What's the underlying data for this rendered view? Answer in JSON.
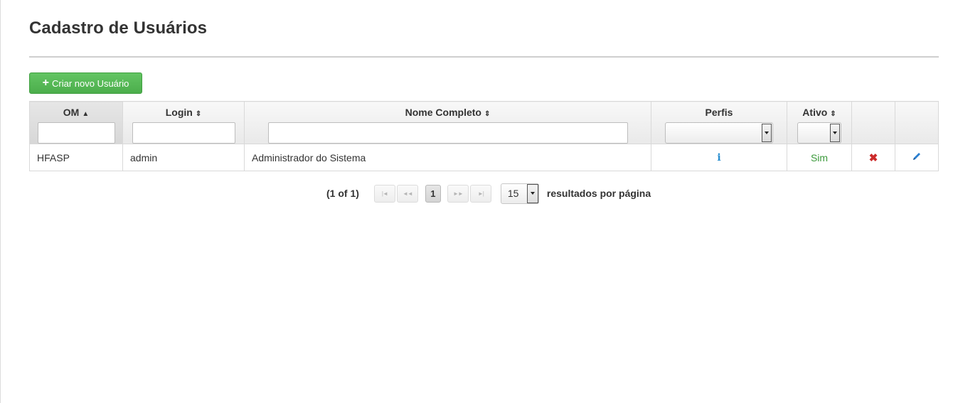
{
  "page": {
    "title": "Cadastro de Usuários"
  },
  "toolbar": {
    "create_label": "Criar novo Usuário",
    "create_icon": "plus-icon"
  },
  "table": {
    "columns": [
      {
        "label": "OM",
        "sort": "ascending",
        "filter": "text"
      },
      {
        "label": "Login",
        "sort": "unsorted",
        "filter": "text"
      },
      {
        "label": "Nome Completo",
        "sort": "unsorted",
        "filter": "text"
      },
      {
        "label": "Perfis",
        "sort": "none",
        "filter": "select"
      },
      {
        "label": "Ativo",
        "sort": "unsorted",
        "filter": "select"
      },
      {
        "label": "",
        "sort": "none",
        "filter": "none"
      },
      {
        "label": "",
        "sort": "none",
        "filter": "none"
      }
    ],
    "sort_icons": {
      "ascending": "▲",
      "unsorted": "⇕"
    },
    "rows": [
      {
        "om": "HFASP",
        "login": "admin",
        "nome": "Administrador do Sistema",
        "perfis_icon": "info-icon",
        "ativo": "Sim",
        "delete_icon": "close-icon",
        "edit_icon": "pencil-icon"
      }
    ]
  },
  "pagination": {
    "current_label": "(1 of 1)",
    "first_glyph": "|◄",
    "prev_glyph": "◄◄",
    "current_page": "1",
    "next_glyph": "►►",
    "last_glyph": "►|",
    "rows_per_page": "15",
    "rows_per_page_label": "resultados por página"
  },
  "colors": {
    "create_button": "#5cb85c",
    "info_icon": "#2a8fd0",
    "ativo_sim": "#3c9a3c",
    "delete_icon": "#cc2a2a",
    "edit_icon": "#2a7fd0"
  }
}
